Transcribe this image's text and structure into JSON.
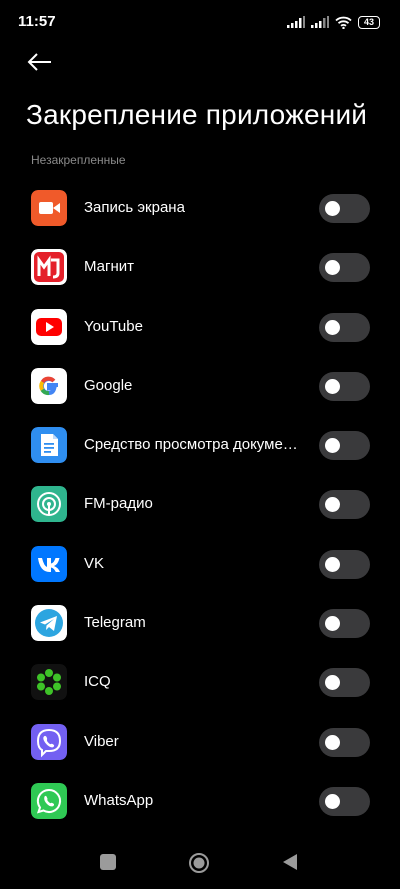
{
  "status_bar": {
    "time": "11:57",
    "battery": "43"
  },
  "header": {
    "title": "Закрепление приложений",
    "section": "Незакрепленные"
  },
  "apps": [
    {
      "name": "Запись экрана",
      "icon": "screen-recorder-icon",
      "pinned": false
    },
    {
      "name": "Магнит",
      "icon": "magnit-icon",
      "pinned": false
    },
    {
      "name": "YouTube",
      "icon": "youtube-icon",
      "pinned": false
    },
    {
      "name": "Google",
      "icon": "google-icon",
      "pinned": false
    },
    {
      "name": "Средство просмотра документ…",
      "icon": "document-viewer-icon",
      "pinned": false
    },
    {
      "name": "FM-радио",
      "icon": "fm-radio-icon",
      "pinned": false
    },
    {
      "name": "VK",
      "icon": "vk-icon",
      "pinned": false
    },
    {
      "name": "Telegram",
      "icon": "telegram-icon",
      "pinned": false
    },
    {
      "name": "ICQ",
      "icon": "icq-icon",
      "pinned": false
    },
    {
      "name": "Viber",
      "icon": "viber-icon",
      "pinned": false
    },
    {
      "name": "WhatsApp",
      "icon": "whatsapp-icon",
      "pinned": false
    }
  ],
  "colors": {
    "background": "#000000",
    "toggle_off": "#3a3a3c",
    "section_text": "#8a8a8a"
  }
}
